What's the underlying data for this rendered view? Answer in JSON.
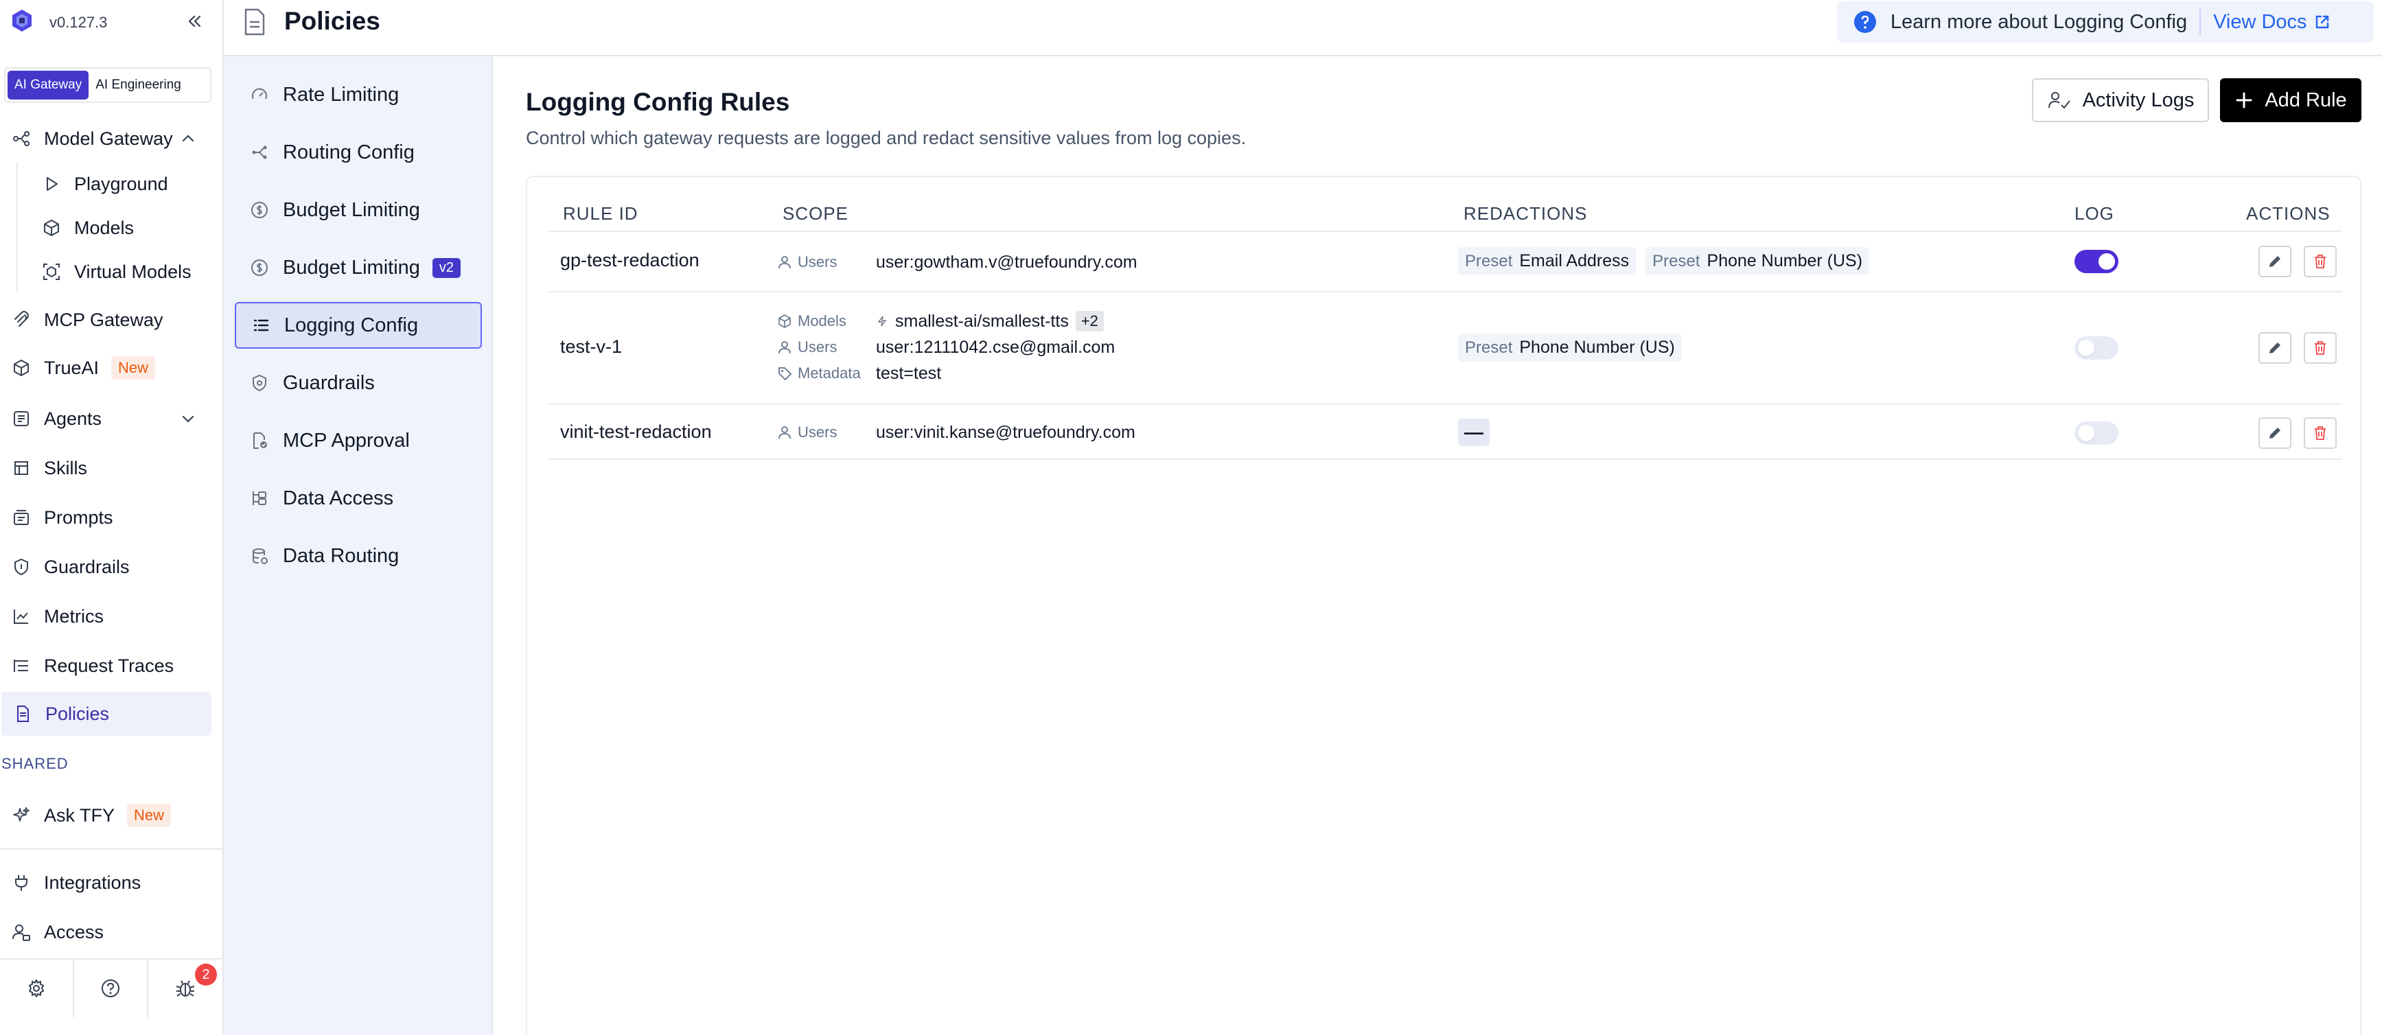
{
  "app": {
    "version": "v0.127.3"
  },
  "segment": {
    "items": [
      "AI Gateway",
      "AI Engineering"
    ],
    "active": "AI Gateway"
  },
  "sidebar": {
    "model_gateway": "Model Gateway",
    "sub_items": [
      "Playground",
      "Models",
      "Virtual Models"
    ],
    "mcp_gateway": "MCP Gateway",
    "trueai": "TrueAI",
    "new_badge": "New",
    "agents": "Agents",
    "skills": "Skills",
    "prompts": "Prompts",
    "guardrails": "Guardrails",
    "metrics": "Metrics",
    "request_traces": "Request Traces",
    "policies": "Policies",
    "shared_label": "SHARED",
    "ask_tfy": "Ask TFY",
    "integrations": "Integrations",
    "access": "Access",
    "bug_count": "2"
  },
  "header": {
    "title": "Policies",
    "help_text": "Learn more about Logging Config",
    "view_docs": "View Docs"
  },
  "subnav": {
    "items": [
      "Rate Limiting",
      "Routing Config",
      "Budget Limiting",
      "Budget Limiting",
      "Logging Config",
      "Guardrails",
      "MCP Approval",
      "Data Access",
      "Data Routing"
    ],
    "v2_badge": "v2",
    "active": "Logging Config"
  },
  "main": {
    "title": "Logging Config Rules",
    "subtitle": "Control which gateway requests are logged and redact sensitive values from log copies.",
    "activity_logs": "Activity Logs",
    "add_rule": "Add Rule"
  },
  "table": {
    "columns": [
      "RULE ID",
      "SCOPE",
      "REDACTIONS",
      "LOG",
      "ACTIONS"
    ],
    "rows": [
      {
        "rule_id": "gp-test-redaction",
        "scope": [
          {
            "key": "Users",
            "value": "user:gowtham.v@truefoundry.com"
          }
        ],
        "redactions": [
          {
            "label": "Preset",
            "value": "Email Address"
          },
          {
            "label": "Preset",
            "value": "Phone Number (US)"
          }
        ],
        "log": true
      },
      {
        "rule_id": "test-v-1",
        "scope": [
          {
            "key": "Models",
            "value": "smallest-ai/smallest-tts",
            "extra": "+2"
          },
          {
            "key": "Users",
            "value": "user:12111042.cse@gmail.com"
          },
          {
            "key": "Metadata",
            "value": "test=test"
          }
        ],
        "redactions": [
          {
            "label": "Preset",
            "value": "Phone Number (US)"
          }
        ],
        "log": false
      },
      {
        "rule_id": "vinit-test-redaction",
        "scope": [
          {
            "key": "Users",
            "value": "user:vinit.kanse@truefoundry.com"
          }
        ],
        "redactions_empty": "—",
        "log": false
      }
    ]
  },
  "colors": {
    "accent": "#4338ca",
    "toggle_on": "#4f2dd6",
    "subnav_bg": "#eef3fc",
    "delete": "#ef4444"
  }
}
